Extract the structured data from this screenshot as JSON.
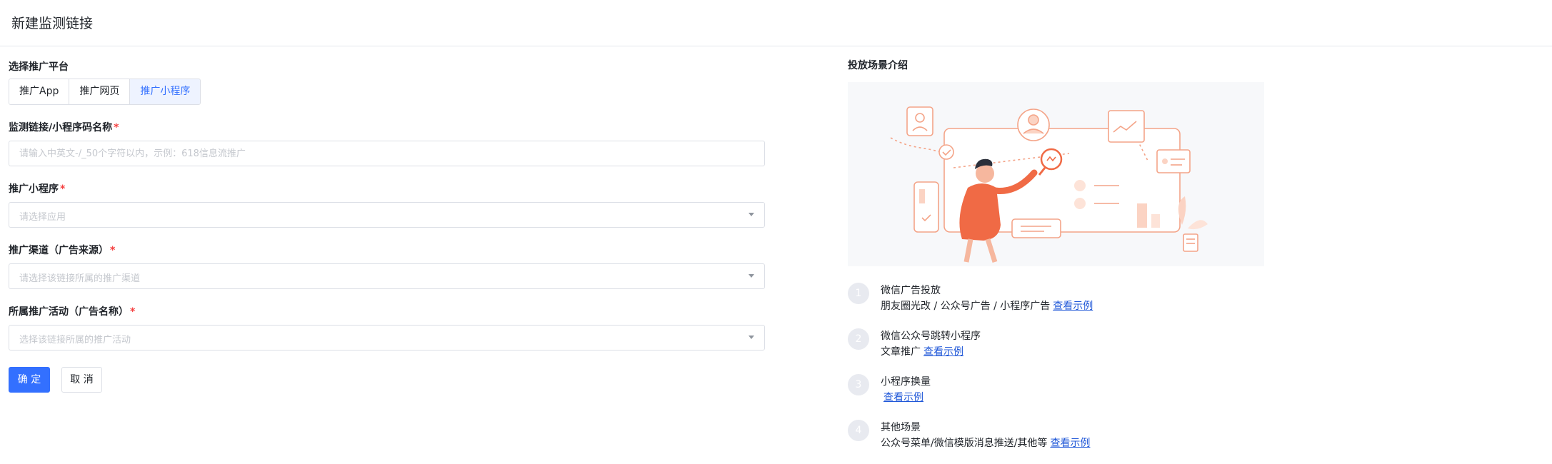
{
  "header": {
    "title": "新建监测链接"
  },
  "platform": {
    "label": "选择推广平台",
    "tabs": [
      {
        "label": "推广App",
        "active": false
      },
      {
        "label": "推广网页",
        "active": false
      },
      {
        "label": "推广小程序",
        "active": true
      }
    ]
  },
  "form": {
    "link_name": {
      "label": "监测链接/小程序码名称",
      "required_mark": "*",
      "placeholder": "请输入中英文-/_50个字符以内，示例：618信息流推广",
      "value": ""
    },
    "mini_program": {
      "label": "推广小程序",
      "required_mark": "*",
      "placeholder": "请选择应用"
    },
    "channel": {
      "label": "推广渠道（广告来源）",
      "required_mark": "*",
      "placeholder": "请选择该链接所属的推广渠道"
    },
    "campaign": {
      "label": "所属推广活动（广告名称）",
      "required_mark": "*",
      "placeholder": "选择该链接所属的推广活动"
    }
  },
  "actions": {
    "confirm": "确 定",
    "cancel": "取 消"
  },
  "scenes": {
    "title": "投放场景介绍",
    "steps": [
      {
        "num": "1",
        "title": "微信广告投放",
        "desc": "朋友圈光改 / 公众号广告 / 小程序广告",
        "link": "查看示例"
      },
      {
        "num": "2",
        "title": "微信公众号跳转小程序",
        "desc": "文章推广",
        "link": "查看示例"
      },
      {
        "num": "3",
        "title": "小程序换量",
        "desc": "",
        "link": "查看示例"
      },
      {
        "num": "4",
        "title": "其他场景",
        "desc": "公众号菜单/微信模版消息推送/其他等",
        "link": "查看示例"
      }
    ]
  },
  "colors": {
    "primary": "#3370ff",
    "illustration_accent": "#f06a45",
    "required": "#f53f3f",
    "link": "#1f57d8"
  }
}
